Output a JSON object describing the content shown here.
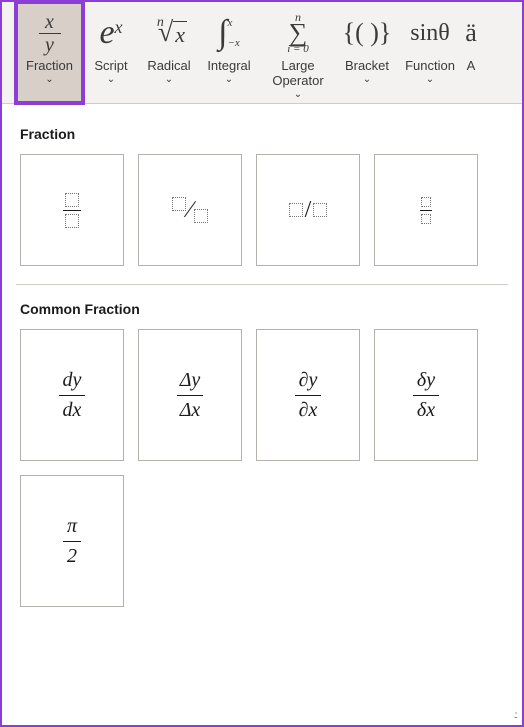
{
  "ribbon": {
    "items": [
      {
        "label": "Fraction"
      },
      {
        "label": "Script"
      },
      {
        "label": "Radical"
      },
      {
        "label": "Integral"
      },
      {
        "label": "Large\nOperator"
      },
      {
        "label": "Bracket"
      },
      {
        "label": "Function"
      },
      {
        "label": "A"
      }
    ]
  },
  "panel": {
    "section1": {
      "title": "Fraction"
    },
    "section2": {
      "title": "Common Fraction",
      "items": [
        {
          "num": "dy",
          "den": "dx"
        },
        {
          "num": "Δy",
          "den": "Δx"
        },
        {
          "num": "∂y",
          "den": "∂x"
        },
        {
          "num": "δy",
          "den": "δx"
        },
        {
          "num": "π",
          "den": "2"
        }
      ]
    }
  }
}
